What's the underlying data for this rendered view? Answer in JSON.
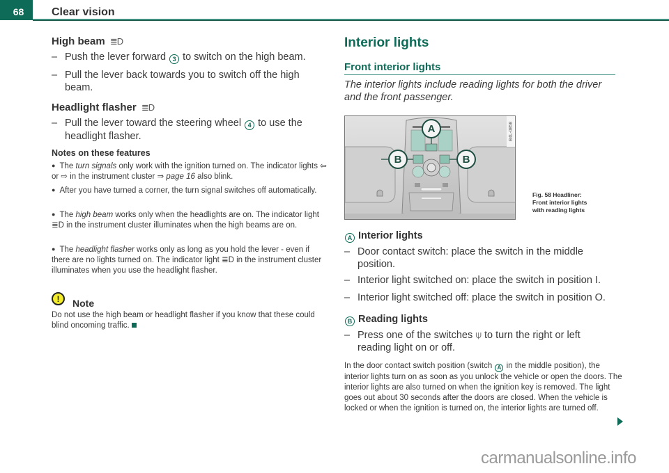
{
  "header": {
    "page_number": "68",
    "section_title": "Clear vision"
  },
  "left": {
    "high_beam": {
      "heading": "High beam",
      "icon": "high-beam-icon",
      "icon_glyph": "≣D",
      "step1_pre": "Push the lever forward",
      "step1_ref": "3",
      "step1_post": "to switch on the high beam.",
      "step2": "Pull the lever back towards you to switch off the high beam."
    },
    "flasher": {
      "heading": "Headlight flasher",
      "icon_glyph": "≣D",
      "step_pre": "Pull the lever toward the steering wheel",
      "step_ref": "4",
      "step_post": "to use the headlight flasher."
    },
    "notes": {
      "heading": "Notes on these features",
      "items": [
        {
          "pre": "The ",
          "em": "turn signals",
          "post": " only work with the ignition turned on. The indicator lights ⇦ or ⇨ in the instrument cluster ⇒ ",
          "page_ref": "page 16",
          "tail": " also blink."
        },
        {
          "text": "After you have turned a corner, the turn signal switches off automatically."
        },
        {
          "pre": "The ",
          "em": "high beam",
          "post": " works only when the headlights are on. The indicator light ≣D in the instrument cluster illuminates when the high beams are on."
        },
        {
          "pre": "The ",
          "em": "headlight flasher",
          "post": " works only as long as you hold the lever - even if there are no lights turned on. The indicator light ≣D in the instrument cluster illuminates when you use the headlight flasher."
        }
      ]
    },
    "note_box": {
      "icon": "warning-icon",
      "icon_glyph": "!",
      "heading": "Note",
      "text": "Do not use the high beam or headlight flasher if you know that these could blind oncoming traffic."
    }
  },
  "right": {
    "title": "Interior lights",
    "subtitle": "Front interior lights",
    "lead": "The interior lights include reading lights for both the driver and the front passenger.",
    "figure": {
      "code": "B4L-0858",
      "callout_a": "A",
      "callout_b": "B",
      "caption_line1": "Fig. 58  Headliner:",
      "caption_line2": "Front interior lights",
      "caption_line3": "with reading lights"
    },
    "interior": {
      "badge": "A",
      "heading": "Interior lights",
      "steps": [
        "Door contact switch: place the switch in the middle position.",
        "Interior light switched on: place the switch in position I.",
        "Interior light switched off: place the switch in position O."
      ]
    },
    "reading": {
      "badge": "B",
      "heading": "Reading lights",
      "step_pre": "Press one of the switches",
      "step_icon_glyph": "⍦",
      "step_post": "to turn the right or left reading light on or off."
    },
    "paragraph_pre": "In the door contact switch position (switch",
    "paragraph_ref": "A",
    "paragraph_post": "in the middle position), the interior lights turn on as soon as you unlock the vehicle or open the doors. The interior lights are also turned on when the ignition key is removed. The light goes out about 30 seconds after the doors are closed. When the vehicle is locked or when the ignition is turned on, the interior lights are turned off."
  },
  "watermark": "carmanualsonline.info",
  "colors": {
    "accent": "#0d6b58",
    "rule": "#3f8f7f",
    "warning_yellow": "#f2ec2a",
    "text": "#3a3a3a"
  }
}
